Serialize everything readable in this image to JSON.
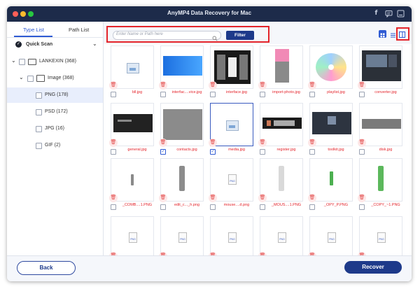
{
  "window": {
    "title": "AnyMP4 Data Recovery for Mac",
    "colors": {
      "titlebar": "#1d2b4a",
      "accent": "#1e3a8a",
      "highlight": "#e4242b"
    }
  },
  "sidebar": {
    "tabs": [
      {
        "label": "Type List"
      },
      {
        "label": "Path List"
      }
    ],
    "quick_scan": {
      "label": "Quick Scan"
    },
    "tree": [
      {
        "label": "LANKEXIN (368)"
      },
      {
        "label": "Image (368)"
      },
      {
        "label": "PNG (178)"
      },
      {
        "label": "PSD (172)"
      },
      {
        "label": "JPG (16)"
      },
      {
        "label": "GIF (2)"
      }
    ]
  },
  "toolbar": {
    "search_placeholder": "Enter Name or Path here",
    "filter_label": "Filter"
  },
  "files": [
    {
      "name": "bll.jpg",
      "thumb": "image-icon",
      "checked": false
    },
    {
      "name": "interfac....vice.jpg",
      "thumb": "blue-banner",
      "checked": false
    },
    {
      "name": "interface.jpg",
      "thumb": "app-panels",
      "checked": false
    },
    {
      "name": "import-photo.jpg",
      "thumb": "pink-gray",
      "checked": false
    },
    {
      "name": "playlist.jpg",
      "thumb": "disc",
      "checked": false
    },
    {
      "name": "converter.jpg",
      "thumb": "dark-ui",
      "checked": false
    },
    {
      "name": "general.jpg",
      "thumb": "dark-strip",
      "checked": false
    },
    {
      "name": "contacts.jpg",
      "thumb": "gray-box",
      "checked": true
    },
    {
      "name": "media.jpg",
      "thumb": "image-icon",
      "checked": true
    },
    {
      "name": "register.jpg",
      "thumb": "dark-stripes",
      "checked": false
    },
    {
      "name": "toolkit.jpg",
      "thumb": "dark-toolkit",
      "checked": false
    },
    {
      "name": "disk.jpg",
      "thumb": "gray-bar",
      "checked": false
    },
    {
      "name": "_COMB....1.PNG",
      "thumb": "small-bar",
      "checked": false
    },
    {
      "name": "edit_c..._h.png",
      "thumb": "gray-pill",
      "checked": false
    },
    {
      "name": "mouse....d.png",
      "thumb": "png-file",
      "checked": false
    },
    {
      "name": "_MOUS....1.PNG",
      "thumb": "light-pill",
      "checked": false
    },
    {
      "name": "_OPY_P.PNG",
      "thumb": "green-thin",
      "checked": false
    },
    {
      "name": "_COPY_~1.PNG",
      "thumb": "green-pill",
      "checked": false
    },
    {
      "name": "",
      "thumb": "png-file",
      "checked": false
    },
    {
      "name": "",
      "thumb": "png-file",
      "checked": false
    },
    {
      "name": "",
      "thumb": "png-file",
      "checked": false
    },
    {
      "name": "",
      "thumb": "png-file",
      "checked": false
    },
    {
      "name": "",
      "thumb": "png-file",
      "checked": false
    },
    {
      "name": "",
      "thumb": "png-file",
      "checked": false
    }
  ],
  "footer": {
    "back_label": "Back",
    "recover_label": "Recover"
  }
}
